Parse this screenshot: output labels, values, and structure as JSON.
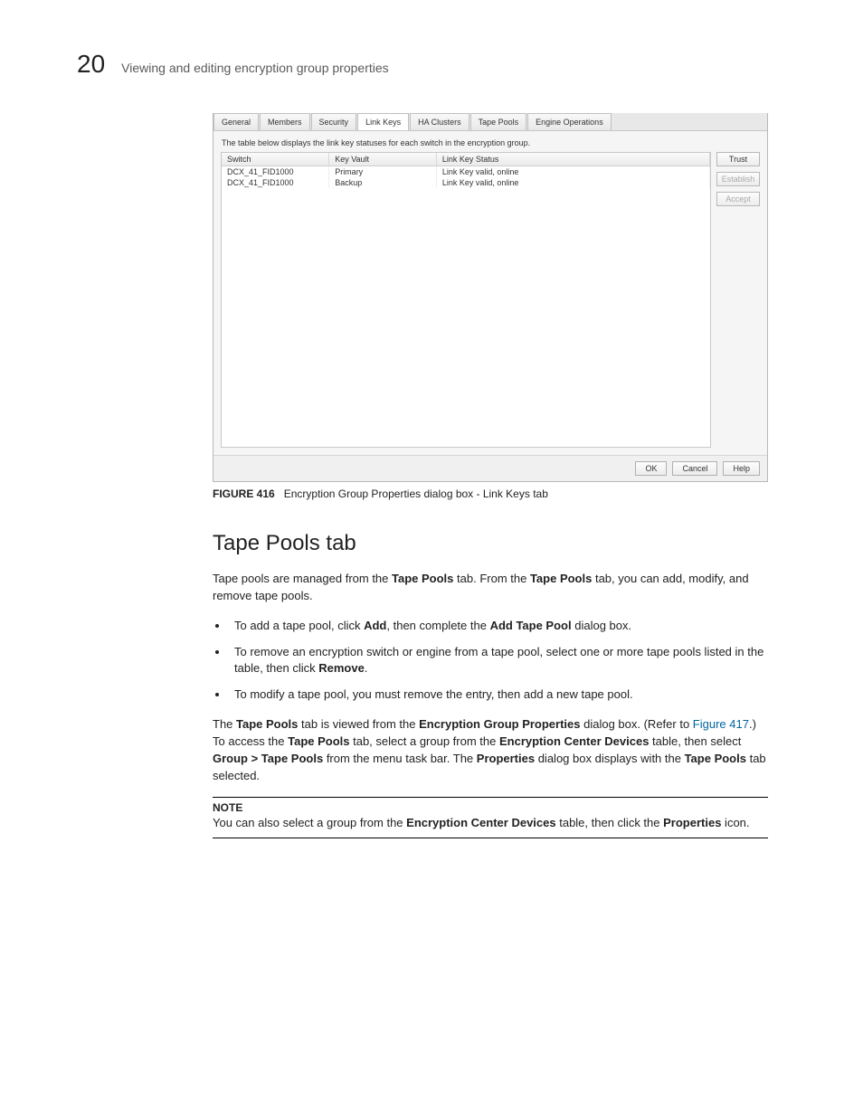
{
  "header": {
    "page_number": "20",
    "running_title": "Viewing and editing encryption group properties"
  },
  "dialog": {
    "tabs": [
      "General",
      "Members",
      "Security",
      "Link Keys",
      "HA Clusters",
      "Tape Pools",
      "Engine Operations"
    ],
    "active_tab": "Link Keys",
    "table_desc": "The table below displays the link key statuses for each switch in the encryption group.",
    "columns": [
      "Switch",
      "Key Vault",
      "Link Key Status"
    ],
    "rows": [
      {
        "switch": "DCX_41_FID1000",
        "key_vault": "Primary",
        "link_key_status": "Link Key valid, online"
      },
      {
        "switch": "DCX_41_FID1000",
        "key_vault": "Backup",
        "link_key_status": "Link Key valid, online"
      }
    ],
    "side_buttons": {
      "trust": "Trust",
      "establish": "Establish",
      "accept": "Accept"
    },
    "footer": {
      "ok": "OK",
      "cancel": "Cancel",
      "help": "Help"
    }
  },
  "figure": {
    "label": "FIGURE 416",
    "caption": "Encryption Group Properties dialog box - Link Keys tab"
  },
  "section": {
    "heading": "Tape Pools tab",
    "para1_a": "Tape pools are managed from the ",
    "para1_b": "Tape Pools",
    "para1_c": " tab. From the ",
    "para1_d": "Tape Pools",
    "para1_e": " tab, you can add, modify, and remove tape pools.",
    "bullets": {
      "b1_a": "To add a tape pool, click ",
      "b1_b": "Add",
      "b1_c": ", then complete the ",
      "b1_d": "Add Tape Pool",
      "b1_e": " dialog box.",
      "b2_a": "To remove an encryption switch or engine from a tape pool, select one or more tape pools listed in the table, then click ",
      "b2_b": "Remove",
      "b2_c": ".",
      "b3": "To modify a tape pool, you must remove the entry, then add a new tape pool."
    },
    "para2_a": "The ",
    "para2_b": "Tape Pools",
    "para2_c": " tab is viewed from the ",
    "para2_d": "Encryption Group Properties",
    "para2_e": " dialog box. (Refer to ",
    "para2_link": "Figure 417",
    "para2_f": ".) To access the ",
    "para2_g": "Tape Pools",
    "para2_h": " tab, select a group from the ",
    "para2_i": "Encryption Center Devices",
    "para2_j": " table, then select ",
    "para2_k": "Group > Tape Pools",
    "para2_l": " from the menu task bar. The ",
    "para2_m": "Properties",
    "para2_n": " dialog box displays with the ",
    "para2_o": "Tape Pools",
    "para2_p": " tab selected."
  },
  "note": {
    "label": "NOTE",
    "text_a": "You can also select a group from the ",
    "text_b": "Encryption Center Devices",
    "text_c": " table, then click the ",
    "text_d": "Properties",
    "text_e": " icon."
  }
}
